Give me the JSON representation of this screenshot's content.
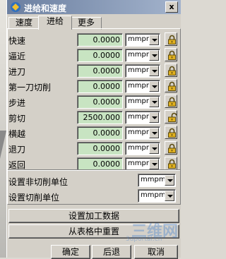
{
  "window": {
    "title": "进给和速度",
    "close_label": "x"
  },
  "tabs": [
    {
      "label": "速度",
      "active": false
    },
    {
      "label": "进给",
      "active": true
    },
    {
      "label": "更多",
      "active": false
    }
  ],
  "rows": [
    {
      "label": "快速",
      "value": "0.0000",
      "unit": "mmpm",
      "locked": true
    },
    {
      "label": "逼近",
      "value": "0.0000",
      "unit": "mmpm",
      "locked": true
    },
    {
      "label": "进刀",
      "value": "0.0000",
      "unit": "mmpm",
      "locked": true
    },
    {
      "label": "第一刀切削",
      "value": "0.0000",
      "unit": "mmpm",
      "locked": true
    },
    {
      "label": "步进",
      "value": "0.0000",
      "unit": "mmpm",
      "locked": true
    },
    {
      "label": "剪切",
      "value": "2500.000",
      "unit": "mmpm",
      "locked": false
    },
    {
      "label": "横越",
      "value": "0.0000",
      "unit": "mmpm",
      "locked": true
    },
    {
      "label": "退刀",
      "value": "0.0000",
      "unit": "mmpm",
      "locked": true
    },
    {
      "label": "返回",
      "value": "0.0000",
      "unit": "mmpm",
      "locked": true
    }
  ],
  "units": {
    "non_cut_label": "设置非切削单位",
    "non_cut_value": "mmpm",
    "cut_label": "设置切削单位",
    "cut_value": "mmpm"
  },
  "buttons": {
    "set_machining_data": "设置加工数据",
    "reset_from_table": "从表格中重置",
    "ok": "确定",
    "back": "后退",
    "cancel": "取消"
  },
  "watermark": {
    "text": "三维网",
    "sub": "3dportal.cn"
  }
}
